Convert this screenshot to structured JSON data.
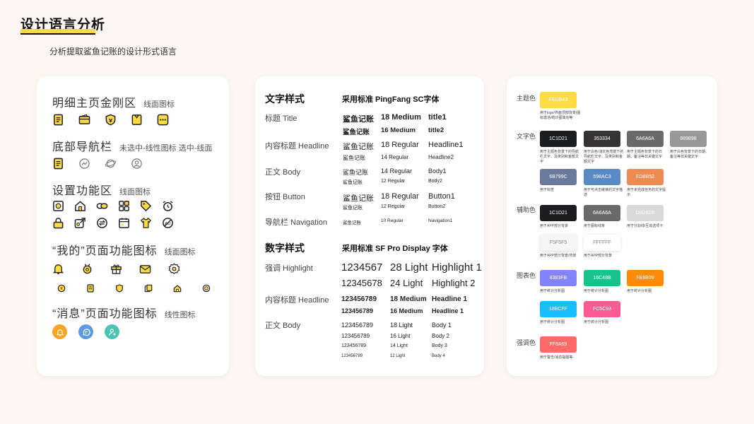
{
  "header": {
    "title": "设计语言分析",
    "subtitle": "分析提取鲨鱼记账的设计形式语言"
  },
  "icon_panel": {
    "sections": [
      {
        "title": "明细主页金刚区",
        "note": "线面图标"
      },
      {
        "title": "底部导航栏",
        "note": "未选中-线性图标 选中-线面"
      },
      {
        "title": "设置功能区",
        "note": "线面图标"
      },
      {
        "title": "“我的”页面功能图标",
        "note": "线面图标"
      },
      {
        "title": "“消息”页面功能图标",
        "note": "线性图标"
      }
    ]
  },
  "typography": {
    "text_header": {
      "title": "文字样式",
      "standard": "采用标准 PingFang SC字体"
    },
    "number_header": {
      "title": "数字样式",
      "standard": "采用标准 SF Pro Display 字体"
    },
    "text_rows": [
      {
        "label": "标题 Title",
        "items": [
          {
            "sample": "鲨鱼记账",
            "size": "18 Medium",
            "name": "title1"
          },
          {
            "sample": "鲨鱼记账",
            "size": "16 Medium",
            "name": "title2"
          }
        ]
      },
      {
        "label": "内容标题 Headline",
        "items": [
          {
            "sample": "鲨鱼记账",
            "size": "18 Regular",
            "name": "Headline1"
          },
          {
            "sample": "鲨鱼记账",
            "size": "14 Regular",
            "name": "Headline2"
          }
        ]
      },
      {
        "label": "正文 Body",
        "items": [
          {
            "sample": "鲨鱼记账",
            "size": "14 Regular",
            "name": "Body1"
          },
          {
            "sample": "鲨鱼记账",
            "size": "12 Regular",
            "name": "Body2"
          }
        ]
      },
      {
        "label": "按钮 Button",
        "items": [
          {
            "sample": "鲨鱼记账",
            "size": "18 Regular",
            "name": "Button1"
          },
          {
            "sample": "鲨鱼记账",
            "size": "12 Regular",
            "name": "Button2"
          }
        ]
      },
      {
        "label": "导航栏 Navigation",
        "items": [
          {
            "sample": "鲨鱼记账",
            "size": "10 Regular",
            "name": "Navigation1"
          }
        ]
      }
    ],
    "number_rows": [
      {
        "label": "强调 Highlight",
        "items": [
          {
            "sample": "1234567",
            "size": "28 Light",
            "name": "Highlight 1"
          },
          {
            "sample": "12345678",
            "size": "24 Light",
            "name": "Highlight 2"
          }
        ]
      },
      {
        "label": "内容标题 Headline",
        "items": [
          {
            "sample": "123456789",
            "size": "18 Medium",
            "name": "Headline 1"
          },
          {
            "sample": "123456789",
            "size": "16 Medium",
            "name": "Headline 1"
          }
        ]
      },
      {
        "label": "正文 Body",
        "items": [
          {
            "sample": "123456789",
            "size": "18 Light",
            "name": "Body 1"
          },
          {
            "sample": "123456789",
            "size": "16 Light",
            "name": "Body 2"
          },
          {
            "sample": "123456789",
            "size": "14 Light",
            "name": "Body 3"
          },
          {
            "sample": "123456789",
            "size": "12 Light",
            "name": "Body 4"
          }
        ]
      }
    ]
  },
  "colors": {
    "categories": [
      "主题色",
      "文字色",
      "辅助色",
      "图表色",
      "强调色"
    ],
    "theme": [
      {
        "hex": "FEDB43",
        "color": "#FEDB43",
        "text": "#ffffff",
        "desc": "用于logo/界面顶部背景/图标激活/统计图填充等"
      }
    ],
    "text": [
      {
        "hex": "1C1D21",
        "color": "#1C1D21",
        "text": "#ffffff",
        "desc": "用于主题色背景下的导航栏文字、及类别和金额文字"
      },
      {
        "hex": "353334",
        "color": "#353334",
        "text": "#ffffff",
        "desc": "用于白色/浅灰色背景下的导航栏文字、及类别和金额文字"
      },
      {
        "hex": "6A6A6A",
        "color": "#6A6A6A",
        "text": "#ffffff",
        "desc": "用于主题色背景下的日期、备注等非关键文字"
      },
      {
        "hex": "989898",
        "color": "#989898",
        "text": "#ffffff",
        "desc": "用于白色背景下的日期、备注等非关键文字"
      },
      {
        "hex": "6B799C",
        "color": "#6B799C",
        "text": "#ffffff",
        "desc": "用于标签"
      },
      {
        "hex": "598AC3",
        "color": "#598AC3",
        "text": "#ffffff",
        "desc": "用于可点击链接的文字描述"
      },
      {
        "hex": "ED8B52",
        "color": "#ED8B52",
        "text": "#ffffff",
        "desc": "用于未完成任务的文字提示"
      }
    ],
    "aux": [
      {
        "hex": "1C1D21",
        "color": "#1C1D21",
        "text": "#ffffff",
        "desc": "用于APP部分背景"
      },
      {
        "hex": "6A6A6A",
        "color": "#6A6A6A",
        "text": "#ffffff",
        "desc": "用于图标线条"
      },
      {
        "hex": "D9D9D9",
        "color": "#D9D9D9",
        "text": "#ffffff",
        "desc": "用于分割线/互动选项卡"
      },
      {
        "hex": "F5F5F5",
        "color": "#F5F5F5",
        "text": "#888888",
        "desc": "用于APP部分背景/背景"
      },
      {
        "hex": "FFFFFF",
        "color": "#FFFFFF",
        "text": "#888888",
        "desc": "用于APP部分背景"
      }
    ],
    "chart": [
      {
        "hex": "8383FB",
        "color": "#8383FB",
        "text": "#ffffff",
        "desc": "用于统计分析图"
      },
      {
        "hex": "16C48B",
        "color": "#16C48B",
        "text": "#ffffff",
        "desc": "用于统计分析图"
      },
      {
        "hex": "FE8B09",
        "color": "#FE8B09",
        "text": "#ffffff",
        "desc": "用于统计分析图"
      },
      {
        "hex": "18BCFF",
        "color": "#18BCFF",
        "text": "#ffffff",
        "desc": "用于统计分析图"
      },
      {
        "hex": "FC5C93",
        "color": "#FC5C93",
        "text": "#ffffff",
        "desc": "用于统计分析图"
      }
    ],
    "accent": [
      {
        "hex": "FF6A69",
        "color": "#FF6A69",
        "text": "#ffffff",
        "desc": "用于警告/消息提醒等"
      }
    ]
  }
}
